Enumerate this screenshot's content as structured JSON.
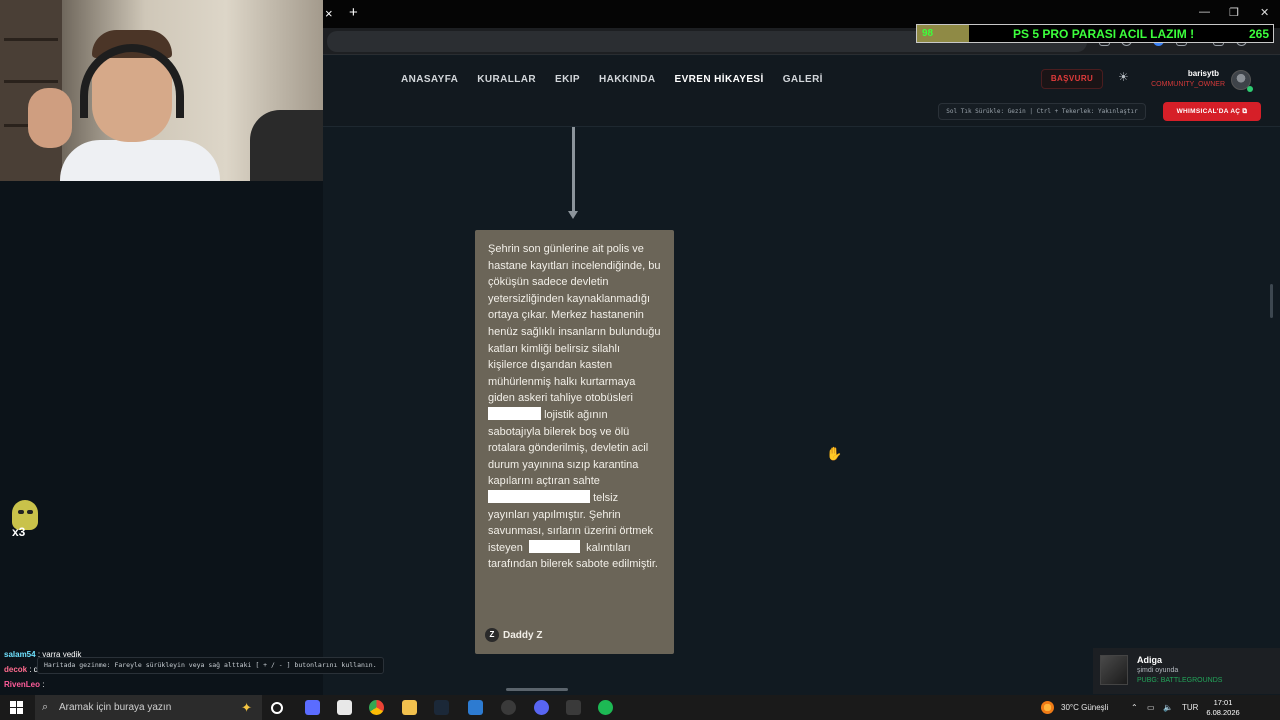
{
  "stream": {
    "chat": [
      {
        "user": "salam54",
        "text": ": yarra yedik"
      },
      {
        "user": "decok",
        "text": ": daddyz"
      },
      {
        "user": "",
        "text": ""
      },
      {
        "user": "RivenLeo",
        "text": ":"
      }
    ],
    "mascot_tag": "x3",
    "overlay": {
      "left_count": "98",
      "text": "PS 5 PRO PARASI ACIL LAZIM !",
      "right_count": "265"
    }
  },
  "browser": {
    "tab_close": "×",
    "tab_new": "+"
  },
  "site": {
    "nav": [
      "ANASAYFA",
      "KURALLAR",
      "EKIP",
      "HAKKINDA",
      "EVREN HİKAYESİ",
      "GALERİ"
    ],
    "apply_label": "BAŞVURU",
    "user_name": "barisytb",
    "user_role": "COMMUNITY_OWNER",
    "hint": "Sol Tık Sürükle: Gezin | Ctrl + Tekerlek: Yakınlaştır",
    "open_button": "WHIMSICAL'DA AÇ"
  },
  "card": {
    "segments": [
      "Şehrin son günlerine ait polis ve hastane kayıtları incelendiğinde, bu çöküşün sadece devletin yetersizliğinden kaynaklanmadığı ortaya çıkar. Merkez hastanenin henüz sağlıklı insanların bulunduğu katları kimliği belirsiz silahlı kişilerce dışarıdan kasten mühürlenmiş  halkı kurtarmaya giden askeri tahliye otobüsleri",
      "lojistik ağının sabotajıyla bilerek boş ve ölü rotalara gönderilmiş, devletin acil durum yayınına sızıp karantina kapılarını açtıran sahte",
      "telsiz yayınları yapılmıştır. Şehrin savunması, sırların üzerini örtmek isteyen",
      "kalıntıları tarafından bilerek sabote edilmiştir."
    ],
    "author": "Daddy Z"
  },
  "nav_hint": "Haritada gezinme: Fareyle sürükleyin veya sağ alttaki [ + / - ] butonlarını kullanın.",
  "toast": {
    "name": "Adiga",
    "status": "şimdi oyunda",
    "game": "PUBG: BATTLEGROUNDS"
  },
  "taskbar": {
    "search_placeholder": "Aramak için buraya yazın",
    "weather": "30°C  Güneşli",
    "lang": "TUR",
    "time": "17:01",
    "date": "6.08.2026"
  }
}
